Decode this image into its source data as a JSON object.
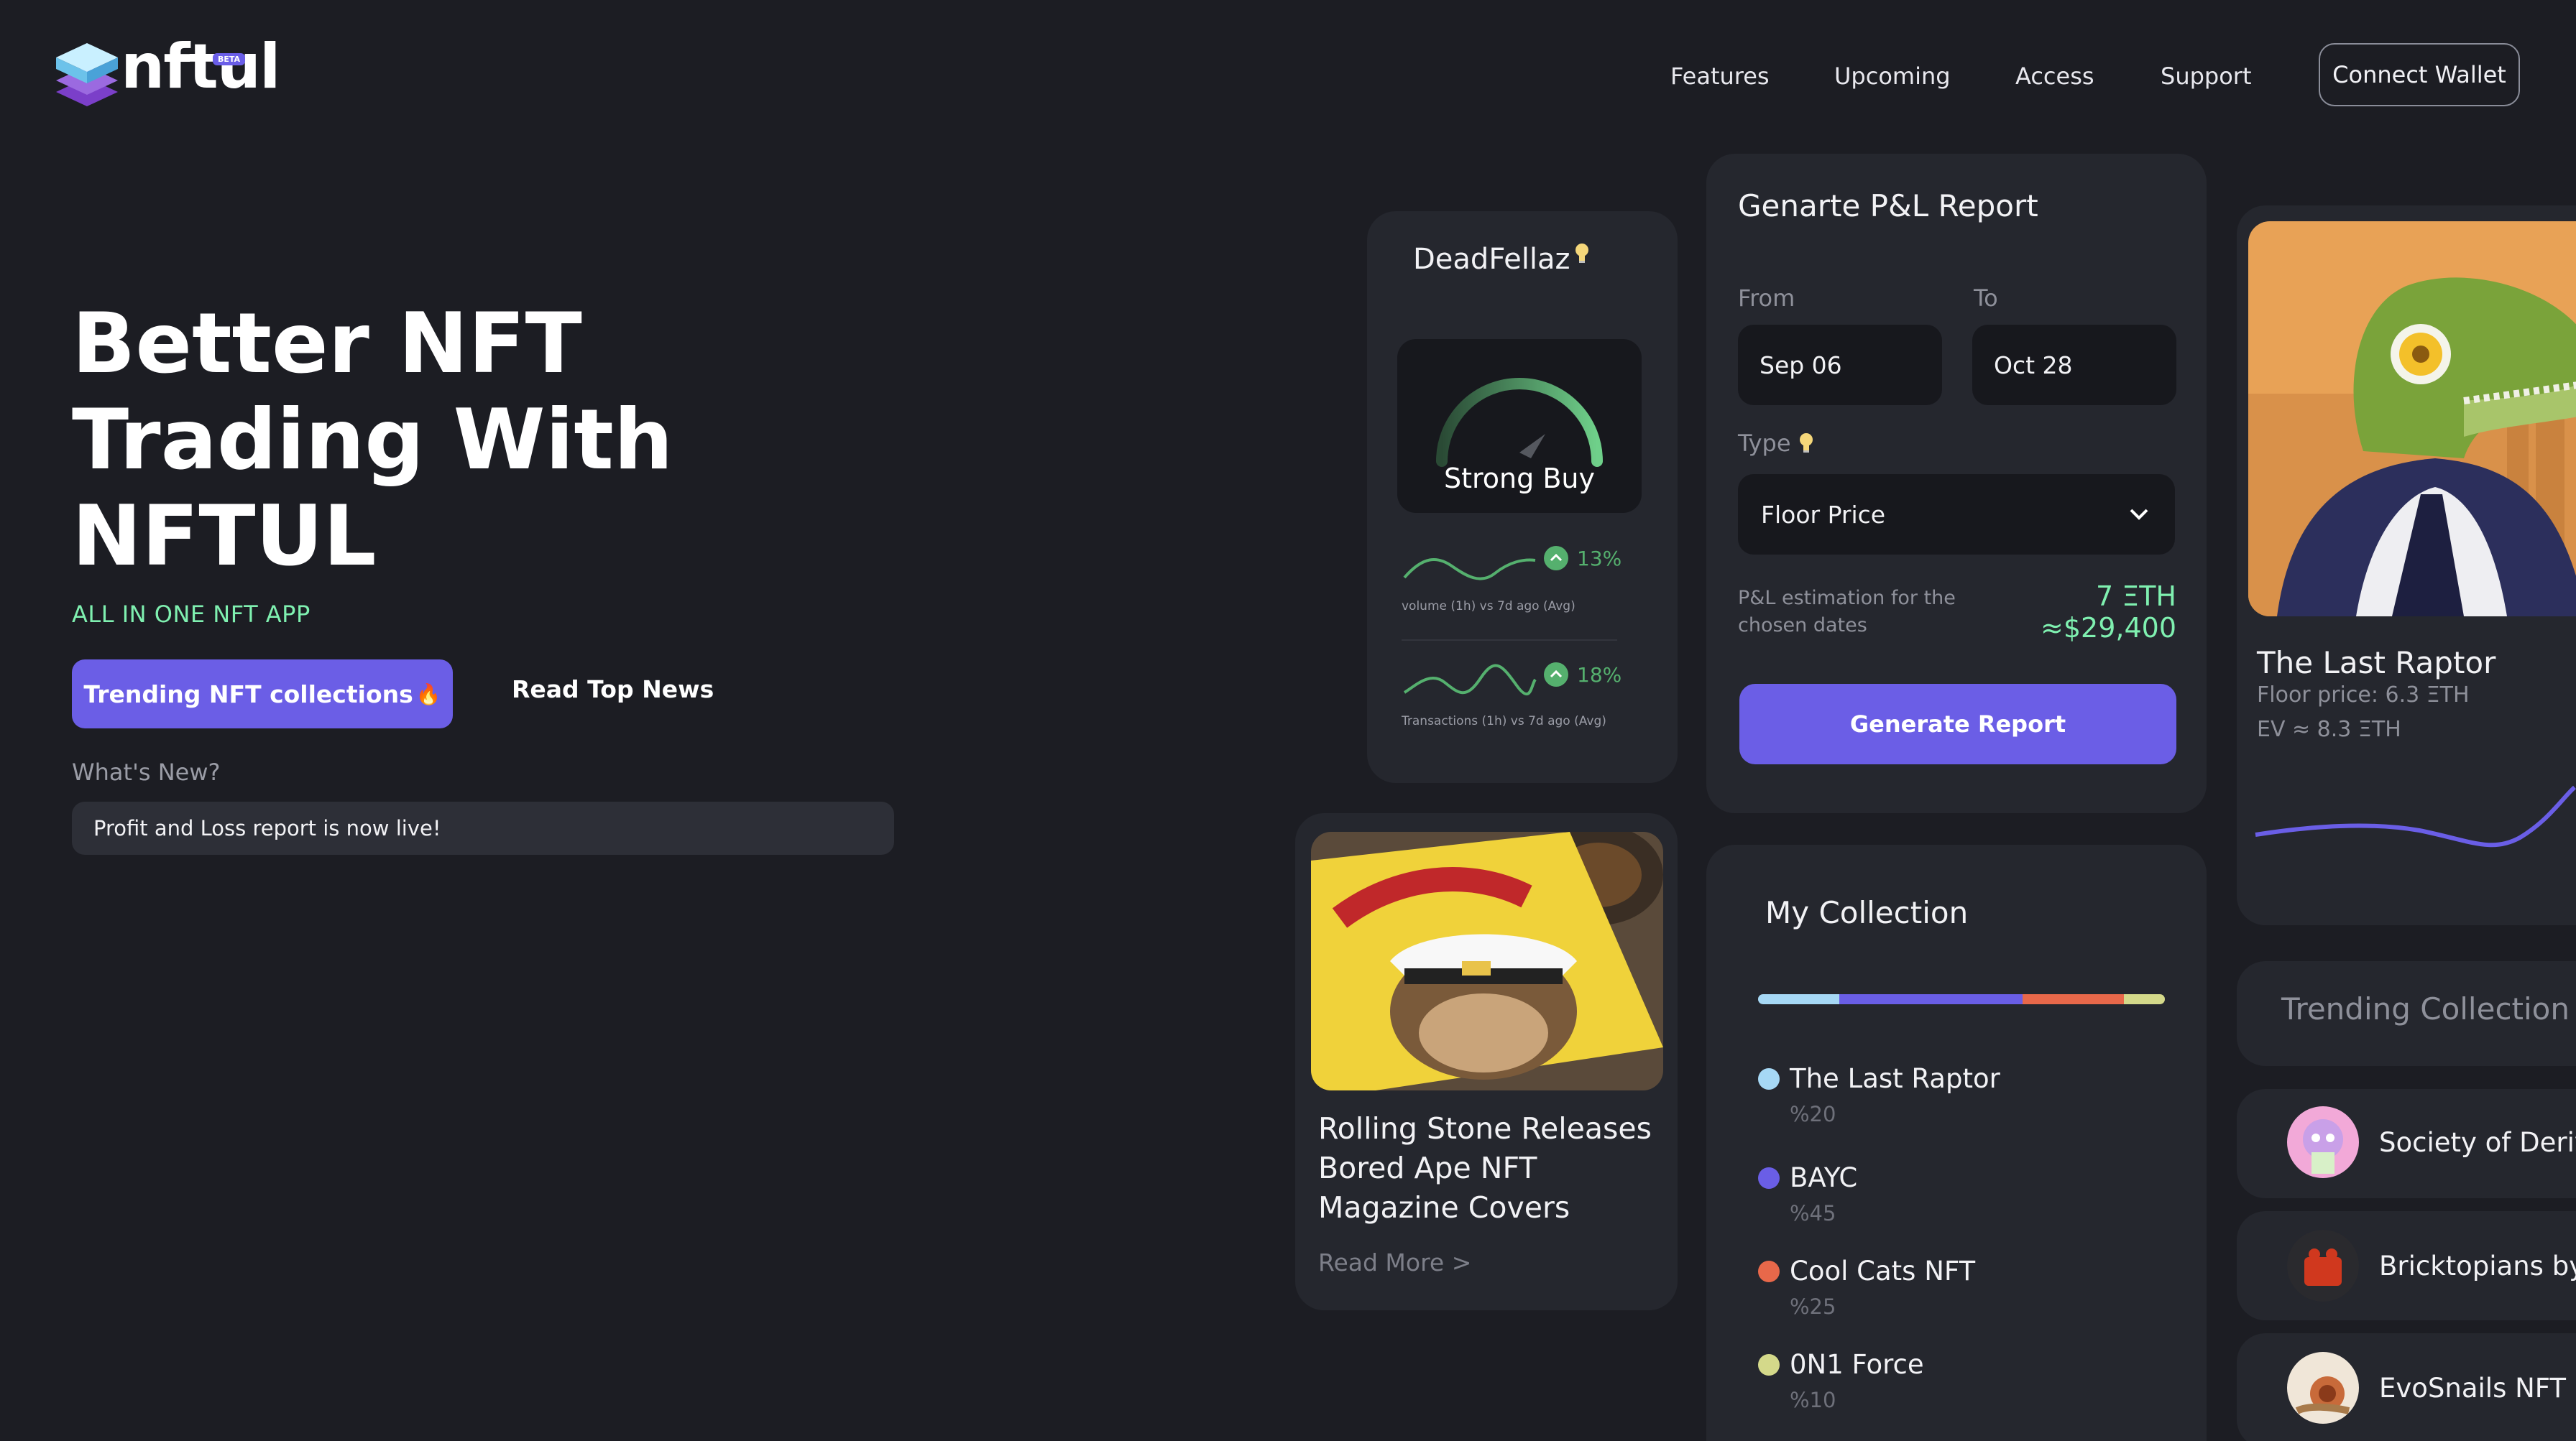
{
  "brand": {
    "name": "nftul",
    "badge": "BETA"
  },
  "nav": {
    "links": [
      "Features",
      "Upcoming",
      "Access",
      "Support"
    ],
    "connect_label": "Connect Wallet"
  },
  "hero": {
    "title_lines": [
      "Better NFT",
      "Trading With",
      "NFTUL"
    ],
    "subtitle": "ALL IN ONE NFT APP",
    "primary_button": "Trending NFT collections",
    "primary_button_emoji": "🔥",
    "secondary_button": "Read Top News",
    "whats_new_label": "What's New?",
    "news_text": "Profit and Loss report is now live!"
  },
  "deadfellaz": {
    "title": "DeadFellaz",
    "signal": "Strong Buy",
    "metrics": [
      {
        "pct": "13%",
        "caption": "volume (1h) vs 7d ago (Avg)"
      },
      {
        "pct": "18%",
        "caption": "Transactions (1h) vs 7d ago (Avg)"
      }
    ]
  },
  "pl_report": {
    "title": "Genarte P&L Report",
    "from_label": "From",
    "from_value": "Sep 06",
    "to_label": "To",
    "to_value": "Oct 28",
    "type_label": "Type",
    "type_value": "Floor Price",
    "estimation_caption": "P&L estimation for the chosen dates",
    "estimation_eth": "7 ΞTH",
    "estimation_usd": "≈$29,400",
    "generate_label": "Generate Report"
  },
  "raptor": {
    "title": "The Last Raptor",
    "floor": "Floor price: 6.3 ΞTH",
    "ev": "EV ≈ 8.3 ΞTH"
  },
  "news_card": {
    "title": "Rolling Stone Releases Bored Ape NFT Magazine Covers",
    "read_more": "Read More >"
  },
  "collection": {
    "title": "My Collection",
    "items": [
      {
        "name": "The Last Raptor",
        "pct": "%20",
        "share": 20,
        "color": "#a6d8f5"
      },
      {
        "name": "BAYC",
        "pct": "%45",
        "share": 45,
        "color": "#6a5ee6"
      },
      {
        "name": "Cool Cats NFT",
        "pct": "%25",
        "share": 25,
        "color": "#e8684a"
      },
      {
        "name": "0N1 Force",
        "pct": "%10",
        "share": 10,
        "color": "#d4d98a"
      }
    ]
  },
  "trending": {
    "title": "Trending Collection",
    "items": [
      {
        "name": "Society of Deriv"
      },
      {
        "name": "Bricktopians by"
      },
      {
        "name": "EvoSnails NFT"
      }
    ]
  },
  "colors": {
    "background": "#1c1d23",
    "card": "#25272e",
    "accent": "#6b5ee6",
    "positive": "#55b06e",
    "highlight": "#7ff0b0"
  }
}
